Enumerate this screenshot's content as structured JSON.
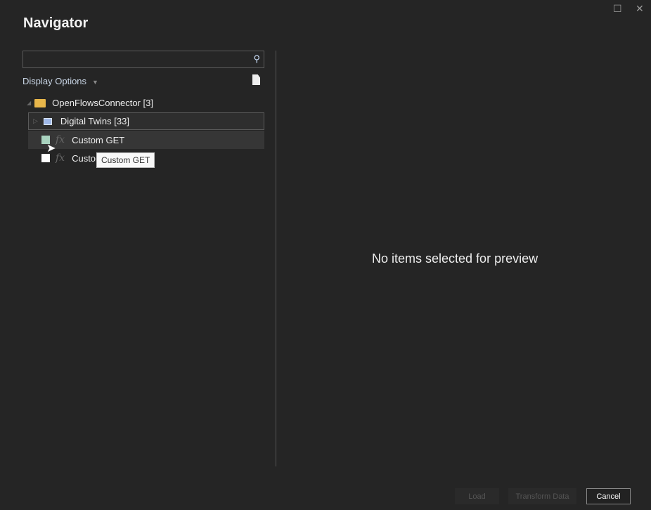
{
  "window": {
    "title": "Navigator",
    "maximize_icon": "square-icon",
    "close_icon": "close-icon"
  },
  "search": {
    "value": "",
    "placeholder": ""
  },
  "display_options": "Display Options",
  "tree": {
    "root": "OpenFlowsConnector [3]",
    "items": [
      {
        "label": "Digital Twins [33]",
        "type": "table"
      },
      {
        "label": "Custom GET",
        "type": "function",
        "checked": false
      },
      {
        "label": "Custom",
        "type": "function",
        "checked": false
      }
    ]
  },
  "tooltip": "Custom GET",
  "preview": {
    "empty_text": "No items selected for preview"
  },
  "buttons": {
    "load": "Load",
    "transform": "Transform Data",
    "cancel": "Cancel"
  }
}
